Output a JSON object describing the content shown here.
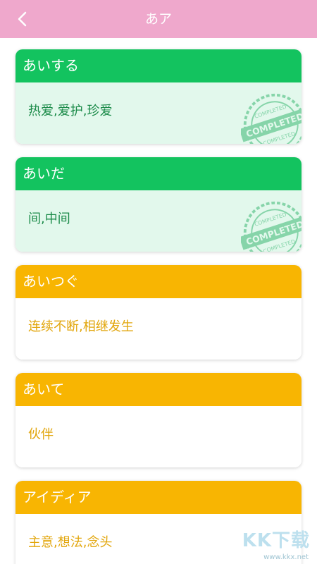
{
  "header": {
    "title": "あア",
    "back_icon": "chevron-left-icon"
  },
  "stamp_text": "COMPLETED",
  "colors": {
    "header_bg": "#efa8cc",
    "done_head": "#13c35f",
    "done_body": "#e2f8ec",
    "todo_head": "#f8b502"
  },
  "items": [
    {
      "word": "あいする",
      "meaning": "热爱,爱护,珍爱",
      "status": "completed"
    },
    {
      "word": "あいだ",
      "meaning": "间,中间",
      "status": "completed"
    },
    {
      "word": "あいつぐ",
      "meaning": "连续不断,相继发生",
      "status": "pending"
    },
    {
      "word": "あいて",
      "meaning": "伙伴",
      "status": "pending"
    },
    {
      "word": "アイディア",
      "meaning": "主意,想法,念头",
      "status": "pending"
    }
  ],
  "watermark": {
    "brand": "KK下载",
    "url": "www.kkx.net"
  }
}
